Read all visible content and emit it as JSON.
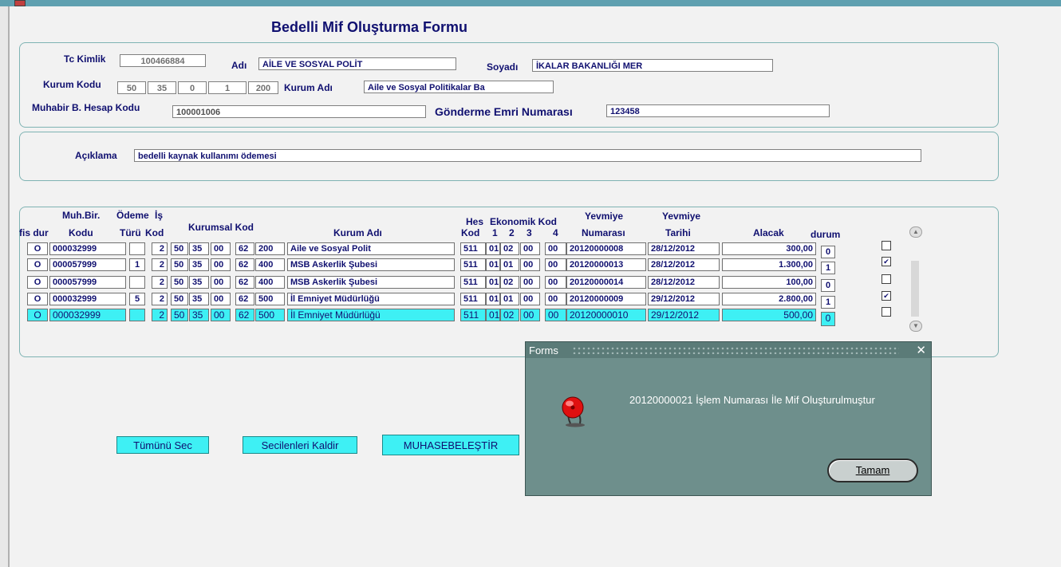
{
  "form": {
    "title": "Bedelli Mif Oluşturma Formu"
  },
  "header": {
    "tc_label": "Tc Kimlik",
    "tc_value": "100466884",
    "adi_label": "Adı",
    "adi_value": "AİLE VE SOSYAL POLİT",
    "soyadi_label": "Soyadı",
    "soyadi_value": "İKALAR BAKANLIĞI MER",
    "kurum_kodu_label": "Kurum Kodu",
    "kurum_kodu": [
      "50",
      "35",
      "0",
      "1",
      "200"
    ],
    "kurum_adi_label": "Kurum Adı",
    "kurum_adi_value": "Aile ve Sosyal Politikalar Ba",
    "muhabir_label": "Muhabir B. Hesap Kodu",
    "muhabir_value": "100001006",
    "gonderme_label": "Gönderme Emri  Numarası",
    "gonderme_value": "123458"
  },
  "aciklama": {
    "label": "Açıklama",
    "value": "bedelli kaynak kullanımı ödemesi"
  },
  "grid": {
    "headers": {
      "fis_dur": "fis dur",
      "muh_bir": "Muh.Bir.",
      "kodu": "Kodu",
      "odeme": "Ödeme",
      "turu": "Türü",
      "is": "İş",
      "kod": "Kod",
      "kurumsal_kod": "Kurumsal Kod",
      "kurum_adi": "Kurum Adı",
      "hes": "Hes",
      "hes_kod": "Kod",
      "ekonomik_kod": "Ekonomik Kod",
      "eko1": "1",
      "eko2": "2",
      "eko3": "3",
      "eko4": "4",
      "yevmiye_no_1": "Yevmiye",
      "yevmiye_no_2": "Numarası",
      "yevmiye_tarih_1": "Yevmiye",
      "yevmiye_tarih_2": "Tarihi",
      "alacak": "Alacak",
      "durum": "durum"
    },
    "rows": [
      {
        "fis": "O",
        "kodu": "000032999",
        "odeme": "",
        "is": "2",
        "k1": "50",
        "k2": "35",
        "k3": "00",
        "k4": "62",
        "k5": "200",
        "kurum_adi": "Aile ve Sosyal Polit",
        "hes": "511",
        "e1": "01",
        "e2": "02",
        "e3": "00",
        "e4": "00",
        "yev_no": "20120000008",
        "yev_tarih": "28/12/2012",
        "alacak": "300,00",
        "durum": "0",
        "check": ""
      },
      {
        "fis": "O",
        "kodu": "000057999",
        "odeme": "1",
        "is": "2",
        "k1": "50",
        "k2": "35",
        "k3": "00",
        "k4": "62",
        "k5": "400",
        "kurum_adi": "MSB Askerlik Şubesi",
        "hes": "511",
        "e1": "01",
        "e2": "01",
        "e3": "00",
        "e4": "00",
        "yev_no": "20120000013",
        "yev_tarih": "28/12/2012",
        "alacak": "1.300,00",
        "durum": "1",
        "check": "✔"
      },
      {
        "fis": "O",
        "kodu": "000057999",
        "odeme": "",
        "is": "2",
        "k1": "50",
        "k2": "35",
        "k3": "00",
        "k4": "62",
        "k5": "400",
        "kurum_adi": "MSB Askerlik Şubesi",
        "hes": "511",
        "e1": "01",
        "e2": "02",
        "e3": "00",
        "e4": "00",
        "yev_no": "20120000014",
        "yev_tarih": "28/12/2012",
        "alacak": "100,00",
        "durum": "0",
        "check": ""
      },
      {
        "fis": "O",
        "kodu": "000032999",
        "odeme": "5",
        "is": "2",
        "k1": "50",
        "k2": "35",
        "k3": "00",
        "k4": "62",
        "k5": "500",
        "kurum_adi": "İl Emniyet Müdürlüğü",
        "hes": "511",
        "e1": "01",
        "e2": "01",
        "e3": "00",
        "e4": "00",
        "yev_no": "20120000009",
        "yev_tarih": "29/12/2012",
        "alacak": "2.800,00",
        "durum": "1",
        "check": "✔"
      },
      {
        "fis": "O",
        "kodu": "000032999",
        "odeme": "",
        "is": "2",
        "k1": "50",
        "k2": "35",
        "k3": "00",
        "k4": "62",
        "k5": "500",
        "kurum_adi": "İl Emniyet Müdürlüğü",
        "hes": "511",
        "e1": "01",
        "e2": "02",
        "e3": "00",
        "e4": "00",
        "yev_no": "20120000010",
        "yev_tarih": "29/12/2012",
        "alacak": "500,00",
        "durum": "0",
        "check": ""
      }
    ]
  },
  "buttons": {
    "tumunu_sec": "Tümünü Sec",
    "secilenleri_kaldir": "Secilenleri Kaldir",
    "muhasebelestir": "MUHASEBELEŞTİR"
  },
  "dialog": {
    "title": "Forms",
    "message": "20120000021 İşlem Numarası İle Mif Oluşturulmuştur",
    "ok_label": "Tamam",
    "close": "✕",
    "icon": "alarm-bell-icon"
  },
  "colors": {
    "accent_cyan": "#3ef0f4",
    "label_navy": "#101070",
    "dialog_bg": "#6e8f8c"
  }
}
